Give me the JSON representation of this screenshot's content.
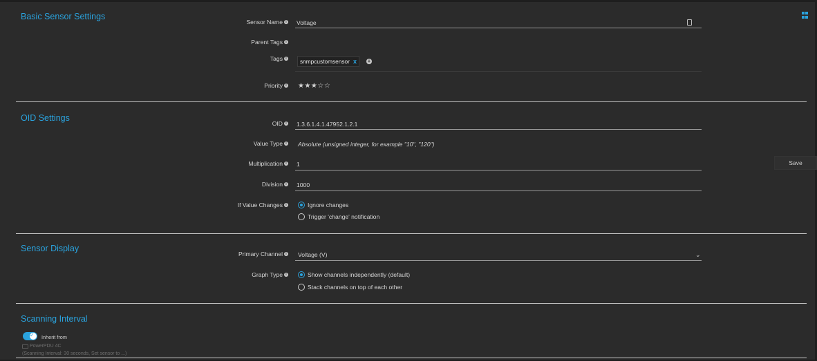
{
  "sections": {
    "basic": "Basic Sensor Settings",
    "oid": "OID Settings",
    "display": "Sensor Display",
    "interval": "Scanning Interval"
  },
  "basic": {
    "sensor_name_label": "Sensor Name",
    "sensor_name_value": "Voltage",
    "parent_tags_label": "Parent Tags",
    "tags_label": "Tags",
    "tag_value": "snmpcustomsensor",
    "tag_remove": "x",
    "priority_label": "Priority",
    "priority_stars": "★★★☆☆",
    "priority_value": 3,
    "priority_max": 5
  },
  "oid": {
    "oid_label": "OID",
    "oid_value": "1.3.6.1.4.1.47952.1.2.1",
    "value_type_label": "Value Type",
    "value_type_value": "Absolute (unsigned integer, for example \"10\", \"120\")",
    "multiplication_label": "Multiplication",
    "multiplication_value": "1",
    "division_label": "Division",
    "division_value": "1000",
    "if_value_changes_label": "If Value Changes",
    "opt_ignore": "Ignore changes",
    "opt_trigger": "Trigger 'change' notification"
  },
  "display": {
    "primary_channel_label": "Primary Channel",
    "primary_channel_value": "Voltage (V)",
    "graph_type_label": "Graph Type",
    "opt_independent": "Show channels independently (default)",
    "opt_stack": "Stack channels on top of each other"
  },
  "interval": {
    "inherit_label": "Inherit from",
    "device": "PowerPDU 4C",
    "note": "(Scanning Interval: 30 seconds, Set sensor to ...)"
  },
  "toolbar": {
    "save_label": "Save"
  },
  "colors": {
    "accent": "#2aa3de",
    "background": "#2b2b2b"
  }
}
